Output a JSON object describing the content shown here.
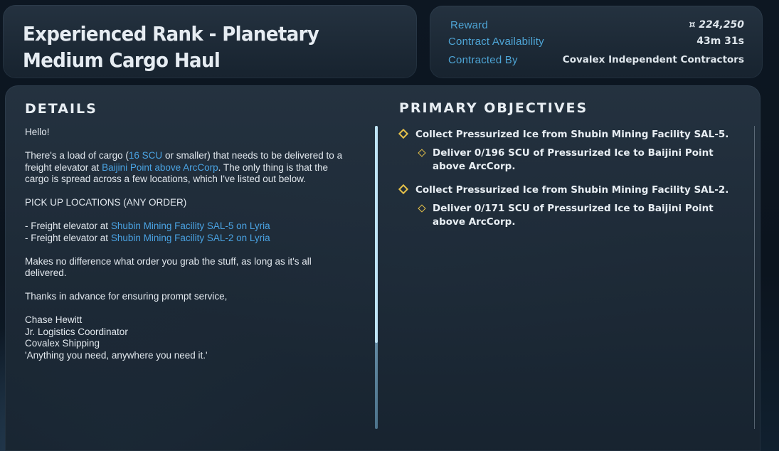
{
  "header": {
    "title": "Experienced Rank - Planetary Medium Cargo Haul"
  },
  "info": {
    "reward_label": "Reward",
    "reward_value": "¤ 224,250",
    "availability_label": "Contract Availability",
    "availability_value": "43m 31s",
    "contracted_by_label": "Contracted By",
    "contracted_by_value": "Covalex Independent Contractors"
  },
  "details": {
    "heading": "DETAILS",
    "greeting": "Hello!",
    "para1_a": "There's a load of cargo (",
    "para1_link1": "16 SCU",
    "para1_b": " or smaller) that needs to be delivered to a freight elevator at ",
    "para1_link2": "Baijini Point above ArcCorp",
    "para1_c": ". The only thing is that the cargo is spread across a few locations, which I've listed out below.",
    "pickup_heading": "PICK UP LOCATIONS (ANY ORDER)",
    "pickups": [
      {
        "prefix": "- Freight elevator at ",
        "location": "Shubin Mining Facility SAL-5 on Lyria"
      },
      {
        "prefix": "- Freight elevator at ",
        "location": "Shubin Mining Facility SAL-2 on Lyria"
      }
    ],
    "para2": "Makes no difference what order you grab the stuff, as long as it's all delivered.",
    "para3": "Thanks in advance for ensuring prompt service,",
    "signature": [
      "Chase Hewitt",
      "Jr. Logistics Coordinator",
      "Covalex Shipping",
      "'Anything you need, anywhere you need it.'"
    ]
  },
  "objectives": {
    "heading": "PRIMARY OBJECTIVES",
    "items": [
      {
        "main": "Collect Pressurized Ice from Shubin Mining Facility SAL-5.",
        "sub": "Deliver 0/196 SCU of Pressurized Ice to Baijini Point above ArcCorp."
      },
      {
        "main": "Collect Pressurized Ice from Shubin Mining Facility SAL-2.",
        "sub": "Deliver 0/171 SCU of Pressurized Ice to Baijini Point above ArcCorp."
      }
    ]
  },
  "colors": {
    "accent_link": "#4aa3e3",
    "label_blue": "#4ea5d6",
    "objective_marker": "#e5c14a"
  },
  "icons": {
    "objective_marker": "diamond-icon"
  }
}
